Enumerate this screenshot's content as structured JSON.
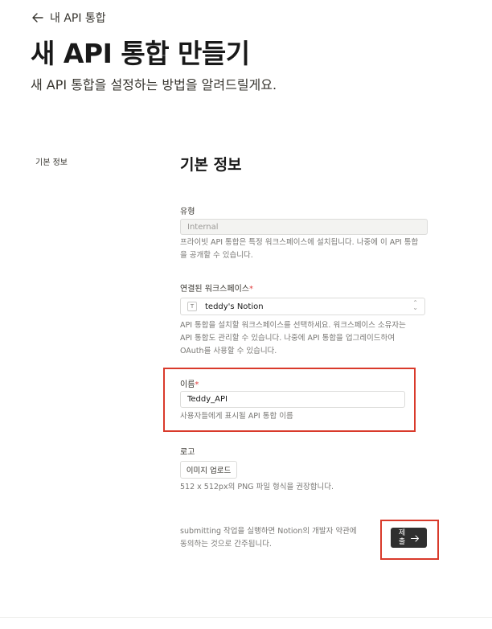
{
  "nav": {
    "back_label": "내 API 통합"
  },
  "header": {
    "title": "새 API 통합 만들기",
    "subtitle": "새 API 통합을 설정하는 방법을 알려드릴게요."
  },
  "sidebar": {
    "label": "기본 정보"
  },
  "section": {
    "title": "기본 정보"
  },
  "form": {
    "type": {
      "label": "유형",
      "value": "Internal",
      "help_line1": "프라이빗 API 통합은 특정 워크스페이스에 설치됩니다. 나중에 이 API 통합",
      "help_line2": "을 공개할 수 있습니다."
    },
    "workspace": {
      "label": "연결된 워크스페이스",
      "required_mark": "*",
      "icon_letter": "T",
      "value": "teddy's Notion",
      "help_line1": "API 통합을 설치할 워크스페이스를 선택하세요. 워크스페이스 소유자는",
      "help_line2": "API 통합도 관리할 수 있습니다. 나중에 API 통합을 업그레이드하여",
      "help_line3": "OAuth를 사용할 수 있습니다."
    },
    "name": {
      "label": "이름",
      "required_mark": "*",
      "value": "Teddy_API",
      "help": "사용자들에게 표시될 API 통합 이름"
    },
    "logo": {
      "label": "로고",
      "button_label": "이미지 업로드",
      "help": "512 x 512px의 PNG 파일 형식을 권장합니다."
    }
  },
  "footer": {
    "terms_line1": "submitting 작업을 실행하면 Notion의 개발자 약관에",
    "terms_line2": "동의하는 것으로 간주됩니다.",
    "submit_label": "제출",
    "submit_icon": "arrow-right-icon"
  },
  "highlight_color": "#d93a2b",
  "required_color": "#e03e3e"
}
